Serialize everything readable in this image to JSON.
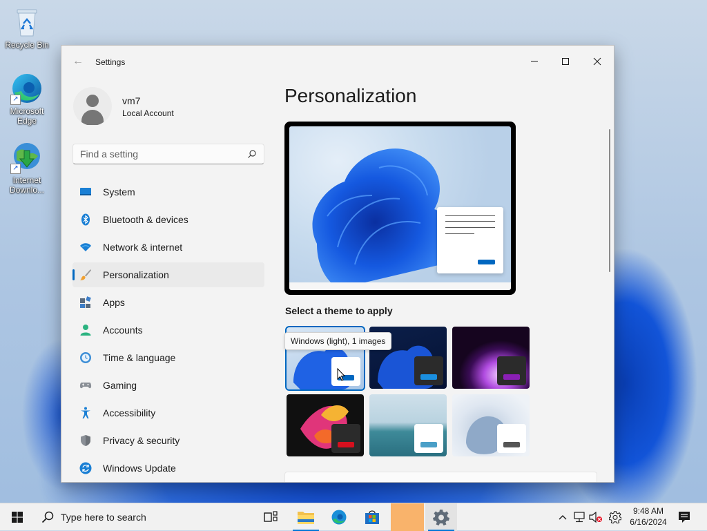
{
  "desktop": {
    "icons": [
      {
        "label": "Recycle Bin"
      },
      {
        "label": "Microsoft Edge"
      },
      {
        "label": "Internet Downlo..."
      }
    ]
  },
  "window": {
    "title": "Settings",
    "back_icon": "back-arrow-icon",
    "controls": {
      "minimize": "–",
      "maximize": "☐",
      "close": "✕"
    }
  },
  "profile": {
    "name": "vm7",
    "type": "Local Account"
  },
  "search": {
    "placeholder": "Find a setting"
  },
  "nav": {
    "items": [
      {
        "label": "System",
        "icon": "system-icon"
      },
      {
        "label": "Bluetooth & devices",
        "icon": "bluetooth-icon"
      },
      {
        "label": "Network & internet",
        "icon": "network-icon"
      },
      {
        "label": "Personalization",
        "icon": "brush-icon",
        "active": true
      },
      {
        "label": "Apps",
        "icon": "apps-icon"
      },
      {
        "label": "Accounts",
        "icon": "accounts-icon"
      },
      {
        "label": "Time & language",
        "icon": "time-language-icon"
      },
      {
        "label": "Gaming",
        "icon": "gaming-icon"
      },
      {
        "label": "Accessibility",
        "icon": "accessibility-icon"
      },
      {
        "label": "Privacy & security",
        "icon": "shield-icon"
      },
      {
        "label": "Windows Update",
        "icon": "windows-update-icon"
      }
    ]
  },
  "main": {
    "title": "Personalization",
    "themes_heading": "Select a theme to apply",
    "tooltip": "Windows (light), 1 images",
    "themes": [
      {
        "id": "windows-light",
        "selected": true
      },
      {
        "id": "windows-dark"
      },
      {
        "id": "glow"
      },
      {
        "id": "captured-motion"
      },
      {
        "id": "sunrise"
      },
      {
        "id": "flow"
      }
    ]
  },
  "taskbar": {
    "search_placeholder": "Type here to search",
    "time": "9:48 AM",
    "date": "6/16/2024"
  },
  "colors": {
    "accent": "#0067c0",
    "taskbar_accent": "#0078d7"
  }
}
